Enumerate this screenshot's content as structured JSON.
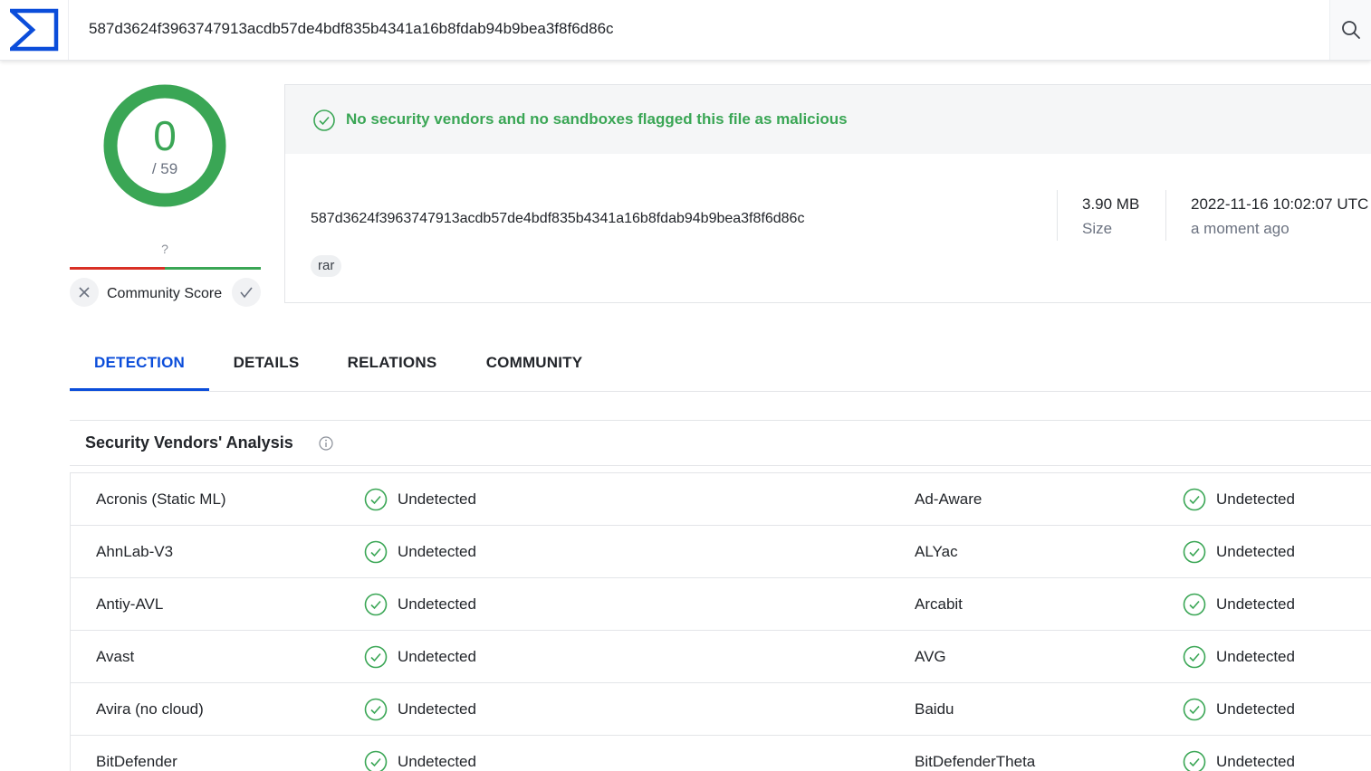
{
  "search": {
    "query": "587d3624f3963747913acdb57de4bdf835b4341a16b8fdab94b9bea3f8f6d86c"
  },
  "score": {
    "detections": "0",
    "total": "/ 59",
    "ring_fraction": 1.0
  },
  "community": {
    "unknown_symbol": "?",
    "label": "Community Score"
  },
  "summary": {
    "banner": "No security vendors and no sandboxes flagged this file as malicious",
    "hash": "587d3624f3963747913acdb57de4bdf835b4341a16b8fdab94b9bea3f8f6d86c",
    "tag": "rar",
    "size_value": "3.90 MB",
    "size_label": "Size",
    "date_value": "2022-11-16 10:02:07 UTC",
    "date_label": "a moment ago"
  },
  "tabs": [
    {
      "label": "DETECTION",
      "active": true
    },
    {
      "label": "DETAILS",
      "active": false
    },
    {
      "label": "RELATIONS",
      "active": false
    },
    {
      "label": "COMMUNITY",
      "active": false
    }
  ],
  "analysis": {
    "title": "Security Vendors' Analysis",
    "rows": [
      {
        "left_vendor": "Acronis (Static ML)",
        "left_status": "Undetected",
        "right_vendor": "Ad-Aware",
        "right_status": "Undetected"
      },
      {
        "left_vendor": "AhnLab-V3",
        "left_status": "Undetected",
        "right_vendor": "ALYac",
        "right_status": "Undetected"
      },
      {
        "left_vendor": "Antiy-AVL",
        "left_status": "Undetected",
        "right_vendor": "Arcabit",
        "right_status": "Undetected"
      },
      {
        "left_vendor": "Avast",
        "left_status": "Undetected",
        "right_vendor": "AVG",
        "right_status": "Undetected"
      },
      {
        "left_vendor": "Avira (no cloud)",
        "left_status": "Undetected",
        "right_vendor": "Baidu",
        "right_status": "Undetected"
      },
      {
        "left_vendor": "BitDefender",
        "left_status": "Undetected",
        "right_vendor": "BitDefenderTheta",
        "right_status": "Undetected"
      }
    ]
  },
  "colors": {
    "accent_blue": "#0b4dda",
    "clean_green": "#3aa655",
    "malicious_red": "#d93025"
  },
  "icons": {
    "logo": "virustotal-logo-icon",
    "search": "search-icon",
    "banner": "check-circle-icon",
    "vote_down": "close-icon",
    "vote_up": "check-icon",
    "info": "info-icon",
    "status": "check-circle-icon"
  }
}
